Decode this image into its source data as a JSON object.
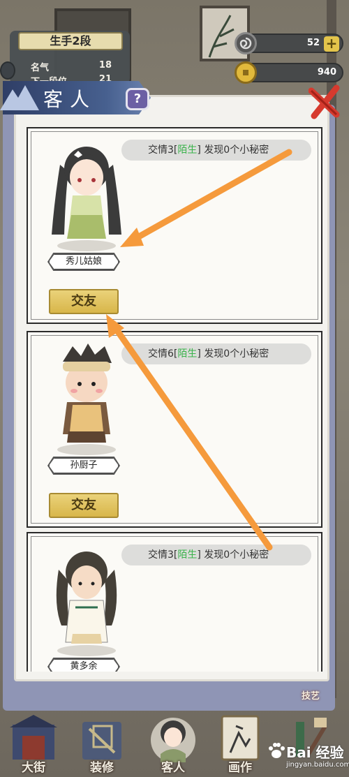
{
  "hud": {
    "rank_title": "生手2段",
    "fame_label": "名气",
    "fame_value": "18",
    "next_label": "下一段位",
    "next_value": "21",
    "currency1_value": "52",
    "currency1_plus": "+",
    "currency2_value": "940"
  },
  "dialog": {
    "title": "客人",
    "help_symbol": "?"
  },
  "guests": [
    {
      "relation_prefix": "交情3[",
      "relation": "陌生",
      "relation_suffix": "] 发现0个小秘密",
      "name": "秀儿姑娘",
      "button": "交友"
    },
    {
      "relation_prefix": "交情6[",
      "relation": "陌生",
      "relation_suffix": "] 发现0个小秘密",
      "name": "孙厨子",
      "button": "交友"
    },
    {
      "relation_prefix": "交情3[",
      "relation": "陌生",
      "relation_suffix": "] 发现0个小秘密",
      "name": "黄多余"
    }
  ],
  "nav": {
    "skill_tag": "技艺",
    "items": [
      {
        "label": "大街",
        "icon": "street-icon"
      },
      {
        "label": "装修",
        "icon": "decorate-icon"
      },
      {
        "label": "客人",
        "icon": "guest-icon"
      },
      {
        "label": "画作",
        "icon": "painting-icon"
      },
      {
        "label": "",
        "icon": "skill-icon"
      }
    ]
  },
  "watermark": {
    "main": "Bai 经验",
    "sub": "jingyan.baidu.com"
  },
  "colors": {
    "relation_green": "#39b24a",
    "friend_button": "#d8b64a",
    "header_blue": "#2f3e66",
    "annotation_arrow": "#f59a3c"
  }
}
